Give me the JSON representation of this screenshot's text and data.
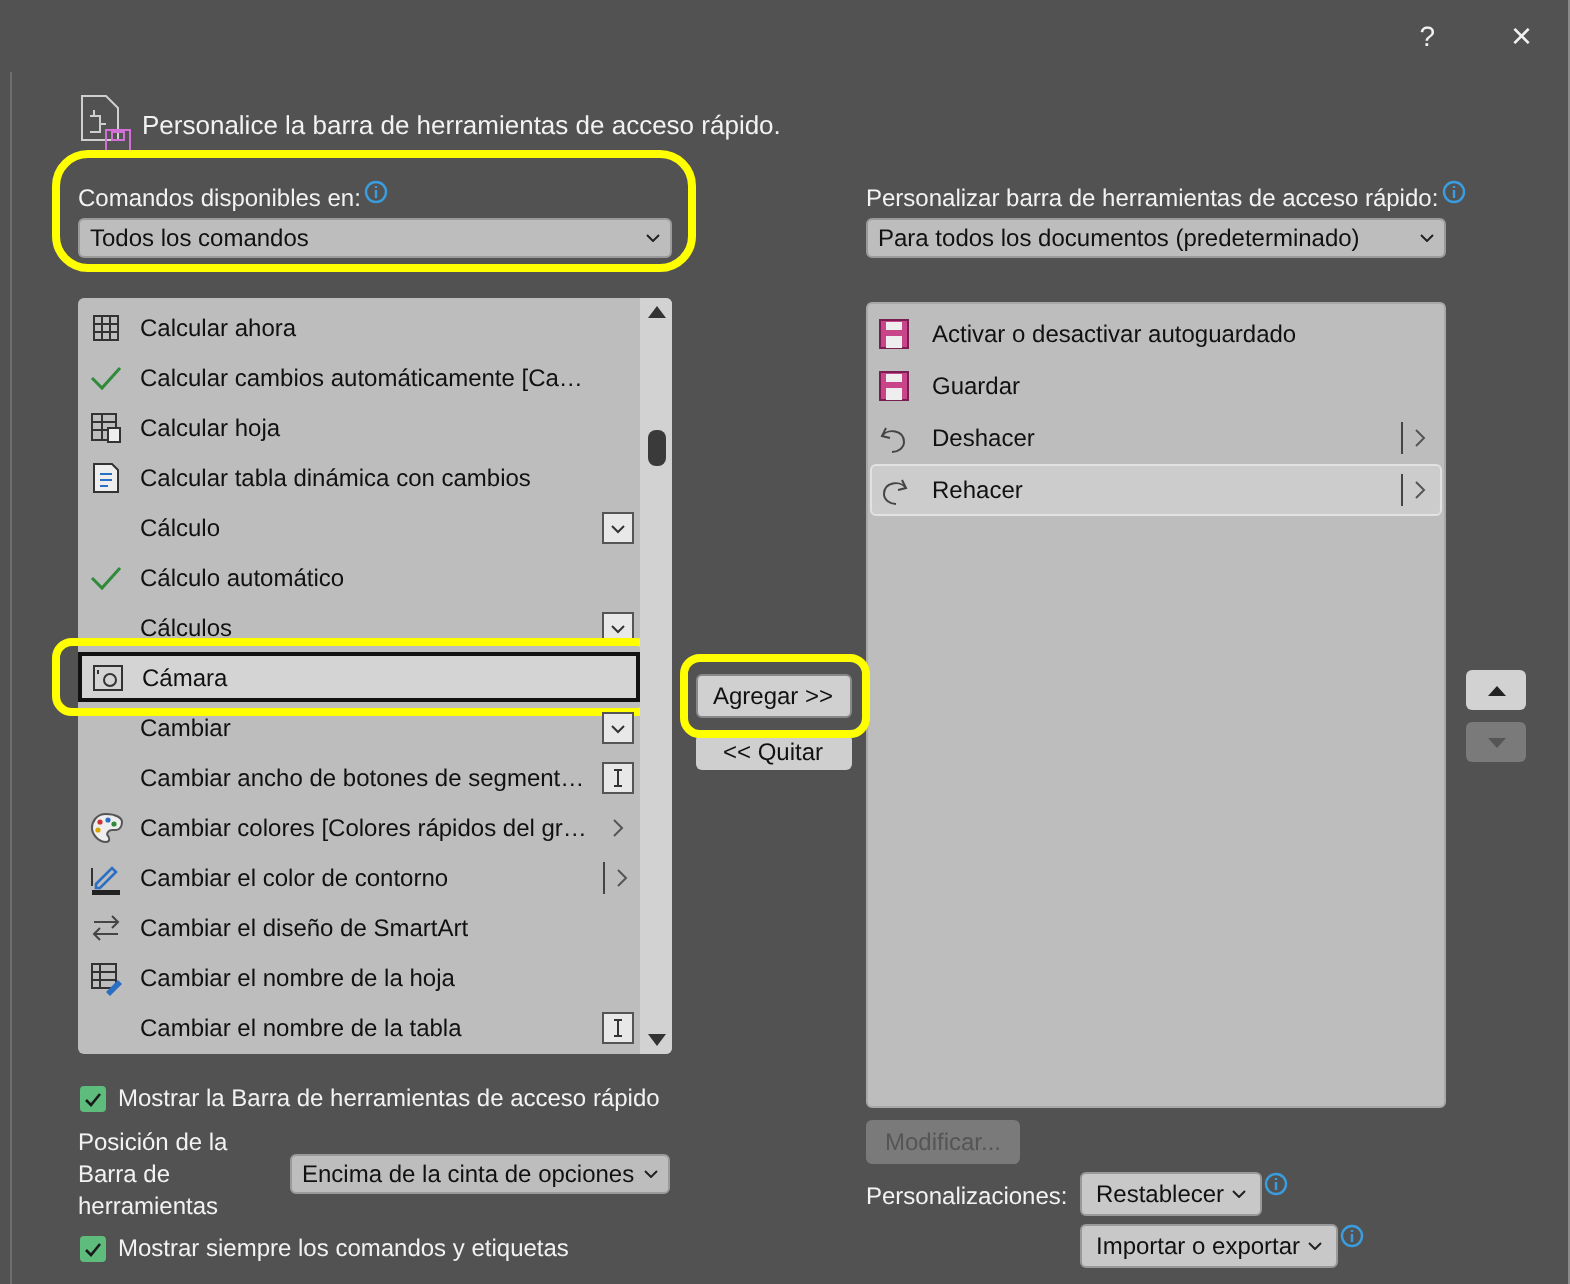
{
  "window": {
    "help": "?",
    "close": "×"
  },
  "header": {
    "title": "Personalice la barra de herramientas de acceso rápido."
  },
  "commands_source": {
    "label": "Comandos disponibles en:",
    "value": "Todos los comandos"
  },
  "commands": [
    {
      "label": "Calcular ahora",
      "kind": "button",
      "selected": false
    },
    {
      "label": "Calcular cambios automáticamente [Ca…",
      "kind": "toggle",
      "selected": false
    },
    {
      "label": "Calcular hoja",
      "kind": "button",
      "selected": false
    },
    {
      "label": "Calcular tabla dinámica con cambios",
      "kind": "button",
      "selected": false
    },
    {
      "label": "Cálculo",
      "kind": "menu",
      "selected": false
    },
    {
      "label": "Cálculo automático",
      "kind": "toggle",
      "selected": false
    },
    {
      "label": "Cálculos",
      "kind": "menu",
      "selected": false
    },
    {
      "label": "Cámara",
      "kind": "button",
      "selected": true
    },
    {
      "label": "Cambiar",
      "kind": "menu",
      "selected": false
    },
    {
      "label": "Cambiar ancho de botones de segment…",
      "kind": "input",
      "selected": false
    },
    {
      "label": "Cambiar colores [Colores rápidos del gr…",
      "kind": "submenu",
      "selected": false
    },
    {
      "label": "Cambiar el color de contorno",
      "kind": "split",
      "selected": false
    },
    {
      "label": "Cambiar el diseño de SmartArt",
      "kind": "button",
      "selected": false
    },
    {
      "label": "Cambiar el nombre de la hoja",
      "kind": "button",
      "selected": false
    },
    {
      "label": "Cambiar el nombre de la tabla",
      "kind": "input",
      "selected": false
    }
  ],
  "add_button": "Agregar >>",
  "remove_button": "<< Quitar",
  "toolbar_scope": {
    "label": "Personalizar barra de herramientas de acceso rápido:",
    "value": "Para todos los documentos (predeterminado)"
  },
  "toolbar_commands": [
    {
      "label": "Activar o desactivar autoguardado",
      "kind": "button",
      "selected": false
    },
    {
      "label": "Guardar",
      "kind": "button",
      "selected": false
    },
    {
      "label": "Deshacer",
      "kind": "split",
      "selected": false
    },
    {
      "label": "Rehacer",
      "kind": "split",
      "selected": true
    }
  ],
  "move_up": {
    "disabled": false
  },
  "move_down": {
    "disabled": true
  },
  "modify_button": {
    "label": "Modificar...",
    "disabled": true
  },
  "show_toolbar": {
    "label": "Mostrar la Barra de herramientas de acceso rápido",
    "checked": true
  },
  "position": {
    "label": "Posición de la Barra de herramientas",
    "value": "Encima de la cinta de opciones"
  },
  "always_show": {
    "label": "Mostrar siempre los comandos y etiquetas",
    "checked": true
  },
  "customizations": {
    "label": "Personalizaciones:",
    "reset": "Restablecer",
    "import_export": "Importar o exportar"
  }
}
